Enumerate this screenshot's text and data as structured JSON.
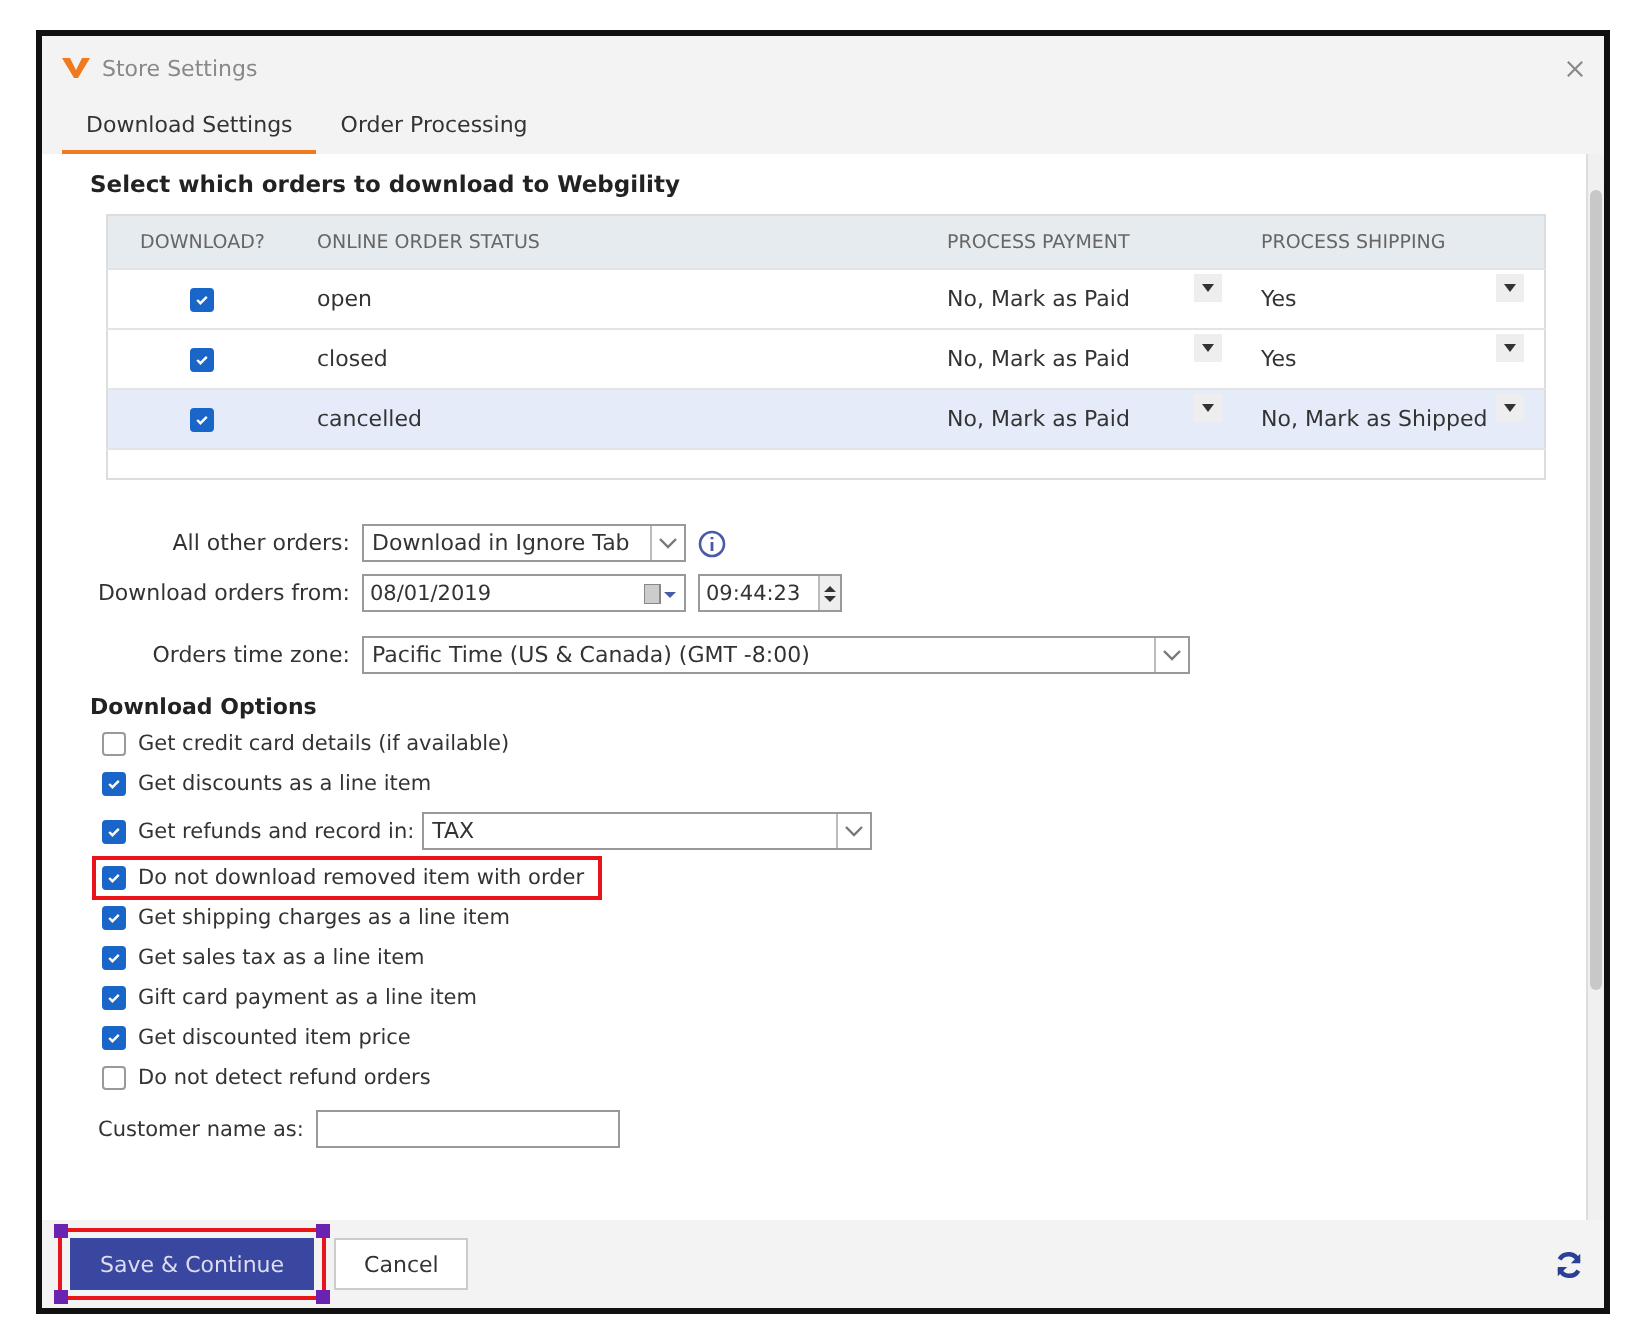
{
  "window": {
    "title": "Store Settings"
  },
  "tabs": [
    {
      "label": "Download Settings",
      "selected": true
    },
    {
      "label": "Order Processing",
      "selected": false
    }
  ],
  "section_title": "Select which orders to download to Webgility",
  "table": {
    "columns": [
      "DOWNLOAD?",
      "ONLINE ORDER STATUS",
      "PROCESS PAYMENT",
      "PROCESS SHIPPING"
    ],
    "rows": [
      {
        "download": true,
        "status": "open",
        "payment": "No, Mark as Paid",
        "shipping": "Yes",
        "selected": false
      },
      {
        "download": true,
        "status": "closed",
        "payment": "No, Mark as Paid",
        "shipping": "Yes",
        "selected": false
      },
      {
        "download": true,
        "status": "cancelled",
        "payment": "No, Mark as Paid",
        "shipping": "No, Mark as Shipped",
        "selected": true
      }
    ]
  },
  "all_other_orders": {
    "label": "All other orders:",
    "value": "Download in Ignore Tab"
  },
  "download_from": {
    "label": "Download orders from:",
    "date": "08/01/2019",
    "time": "09:44:23"
  },
  "time_zone": {
    "label": "Orders time zone:",
    "value": "Pacific Time (US & Canada) (GMT -8:00)"
  },
  "download_options": {
    "title": "Download Options",
    "items": [
      {
        "kind": "checkbox",
        "label": "Get credit card details (if available)",
        "checked": false,
        "highlighted": false
      },
      {
        "kind": "checkbox",
        "label": "Get discounts as a line item",
        "checked": true,
        "highlighted": false
      },
      {
        "kind": "select",
        "label": "Get refunds and record in:",
        "checked": true,
        "value": "TAX",
        "highlighted": false
      },
      {
        "kind": "checkbox",
        "label": "Do not download removed item with order",
        "checked": true,
        "highlighted": true
      },
      {
        "kind": "checkbox",
        "label": "Get shipping charges as a line item",
        "checked": true,
        "highlighted": false
      },
      {
        "kind": "checkbox",
        "label": "Get sales tax as a line item",
        "checked": true,
        "highlighted": false
      },
      {
        "kind": "checkbox",
        "label": "Gift card payment as a line item",
        "checked": true,
        "highlighted": false
      },
      {
        "kind": "checkbox",
        "label": "Get discounted item price",
        "checked": true,
        "highlighted": false
      },
      {
        "kind": "checkbox",
        "label": "Do not detect refund orders",
        "checked": false,
        "highlighted": false
      }
    ]
  },
  "customer_name": {
    "label": "Customer name as:"
  },
  "buttons": [
    {
      "label": "Save & Continue",
      "kind": "primary",
      "highlighted": true
    },
    {
      "label": "Cancel",
      "kind": "secondary",
      "highlighted": false
    }
  ]
}
